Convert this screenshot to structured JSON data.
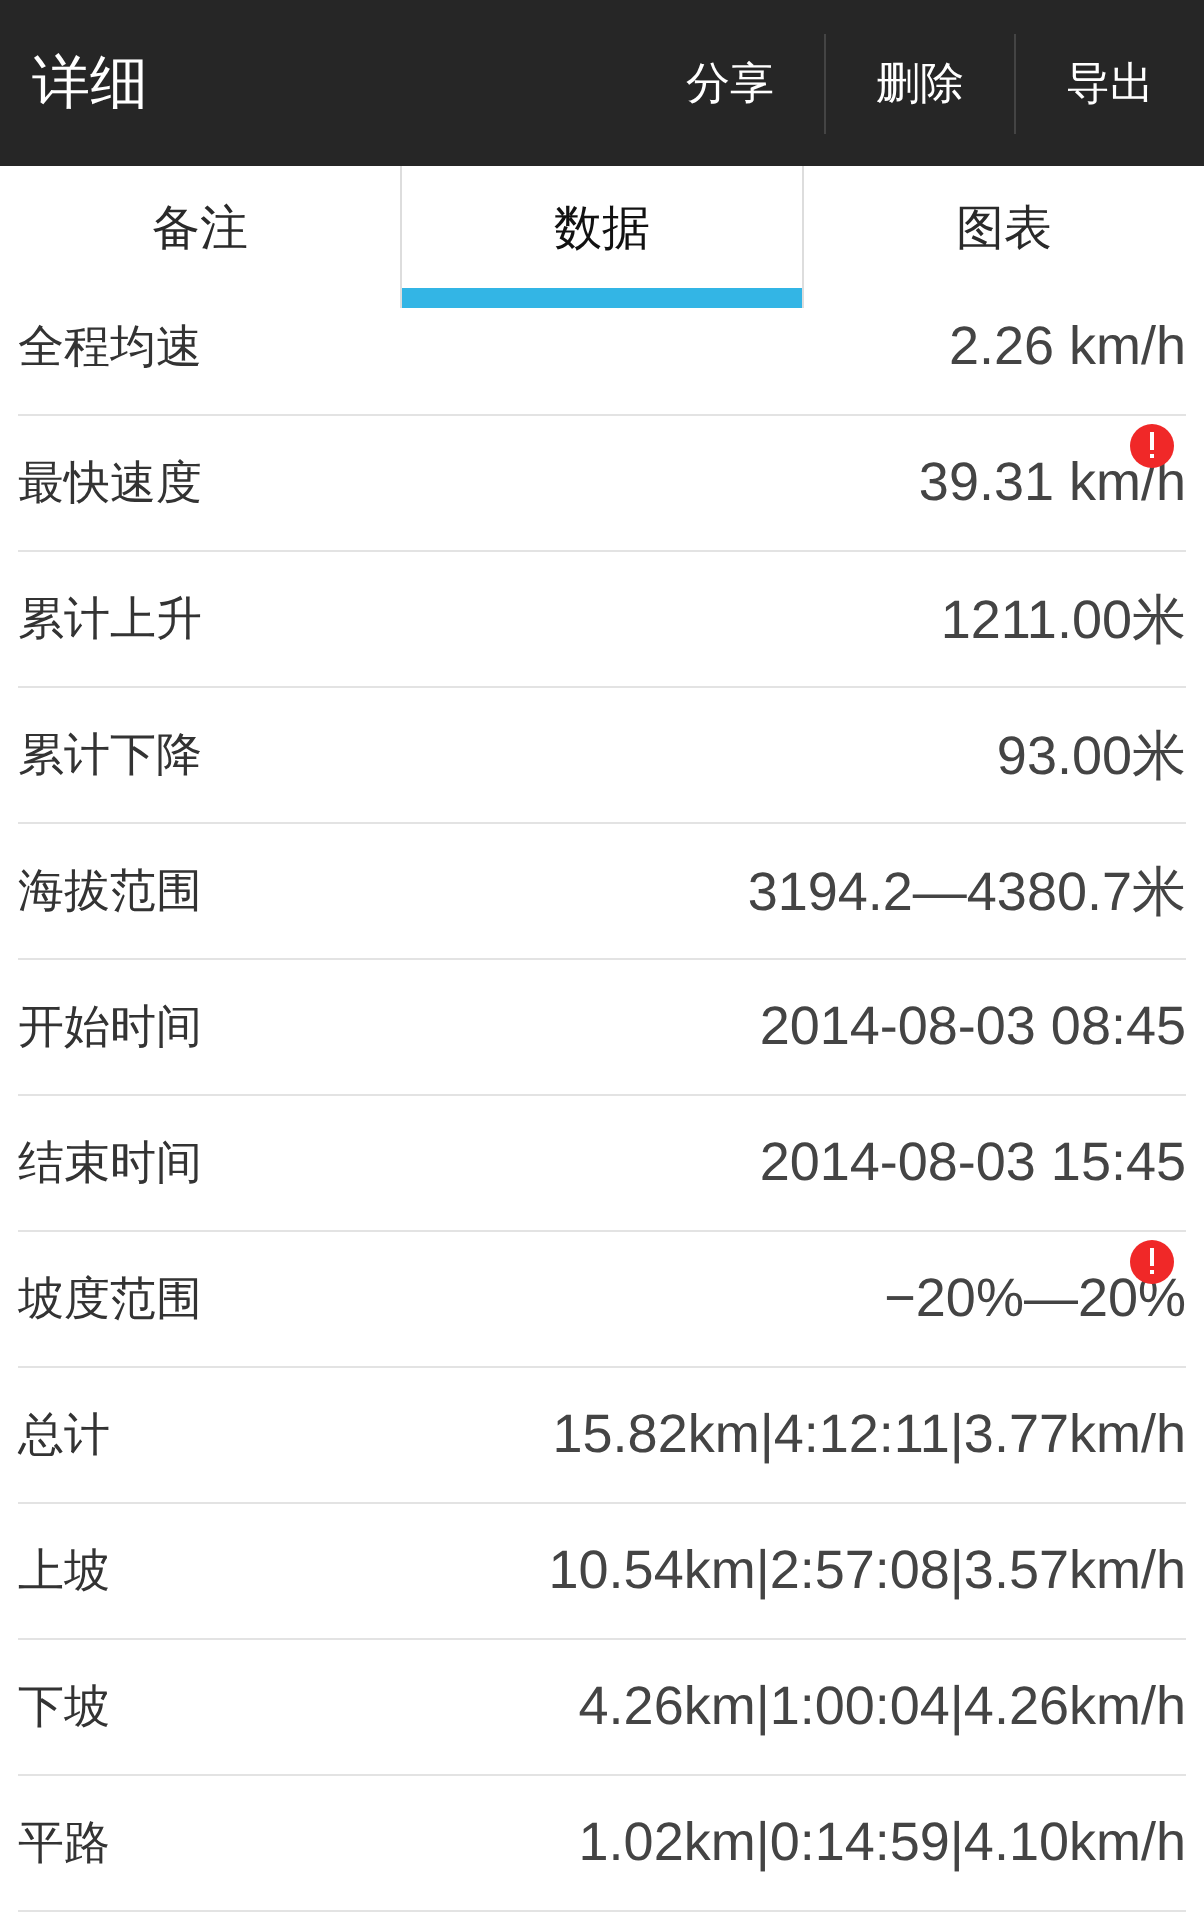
{
  "header": {
    "title": "详细",
    "actions": [
      "分享",
      "删除",
      "导出"
    ]
  },
  "tabs": [
    {
      "label": "备注",
      "selected": false
    },
    {
      "label": "数据",
      "selected": true
    },
    {
      "label": "图表",
      "selected": false
    }
  ],
  "rows": [
    {
      "label": "全程均速",
      "value": "2.26 km/h",
      "warning": false
    },
    {
      "label": "最快速度",
      "value": "39.31 km/h",
      "warning": true
    },
    {
      "label": "累计上升",
      "value": "1211.00米",
      "warning": false
    },
    {
      "label": "累计下降",
      "value": "93.00米",
      "warning": false
    },
    {
      "label": "海拔范围",
      "value": "3194.2—4380.7米",
      "warning": false
    },
    {
      "label": "开始时间",
      "value": "2014-08-03 08:45",
      "warning": false
    },
    {
      "label": "结束时间",
      "value": "2014-08-03 15:45",
      "warning": false
    },
    {
      "label": "坡度范围",
      "value": "−20%—20%",
      "warning": true
    },
    {
      "label": "总计",
      "value": "15.82km|4:12:11|3.77km/h",
      "warning": false
    },
    {
      "label": "上坡",
      "value": "10.54km|2:57:08|3.57km/h",
      "warning": false
    },
    {
      "label": "下坡",
      "value": "4.26km|1:00:04|4.26km/h",
      "warning": false
    },
    {
      "label": "平路",
      "value": "1.02km|0:14:59|4.10km/h",
      "warning": false
    }
  ]
}
